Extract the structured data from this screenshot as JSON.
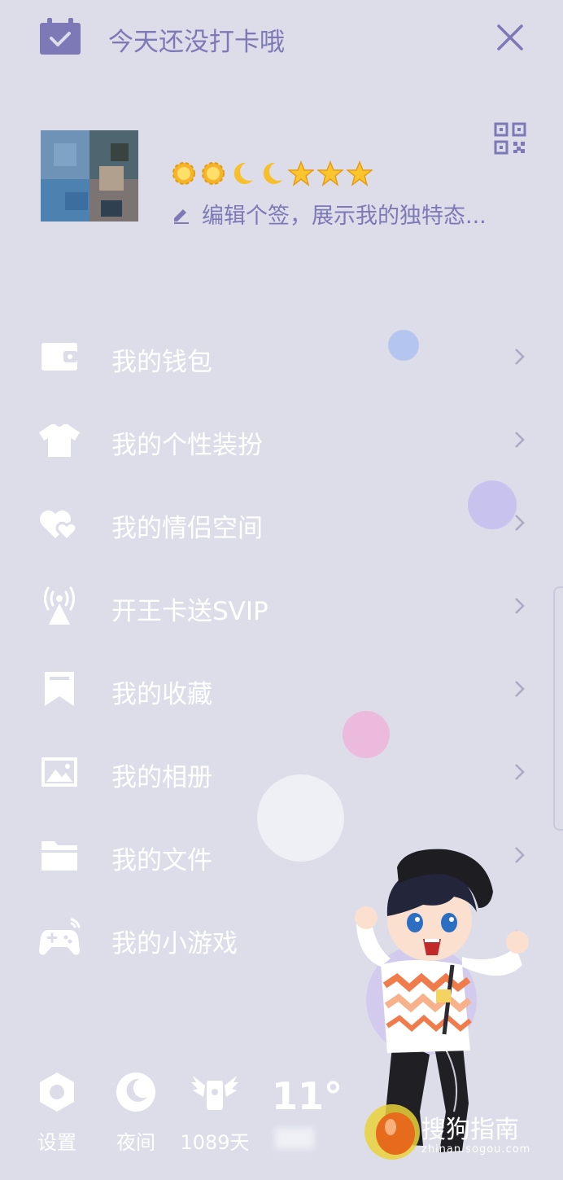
{
  "header": {
    "checkin_text": "今天还没打卡哦",
    "calendar_icon": "calendar-check-icon",
    "close_icon": "close-icon"
  },
  "profile": {
    "signature": "编辑个签，展示我的独特态...",
    "level_icons": [
      "sun",
      "sun",
      "moon",
      "moon",
      "star",
      "star",
      "star"
    ],
    "qr_icon": "qr-code-icon"
  },
  "menu": {
    "items": [
      {
        "label": "我的钱包",
        "icon": "wallet-icon"
      },
      {
        "label": "我的个性装扮",
        "icon": "shirt-icon"
      },
      {
        "label": "我的情侣空间",
        "icon": "hearts-icon"
      },
      {
        "label": "开王卡送SVIP",
        "icon": "antenna-icon"
      },
      {
        "label": "我的收藏",
        "icon": "bookmark-icon"
      },
      {
        "label": "我的相册",
        "icon": "image-icon"
      },
      {
        "label": "我的文件",
        "icon": "folder-icon"
      },
      {
        "label": "我的小游戏",
        "icon": "gamepad-icon"
      }
    ]
  },
  "bottom": {
    "settings_label": "设置",
    "night_label": "夜间",
    "days_label": "1089天",
    "temperature": "11°"
  },
  "watermark": {
    "brand": "搜狗指南",
    "url": "zhinan.sogou.com"
  },
  "colors": {
    "background": "#dcdde9",
    "accent": "#7d79b6",
    "text": "#ffffff"
  }
}
